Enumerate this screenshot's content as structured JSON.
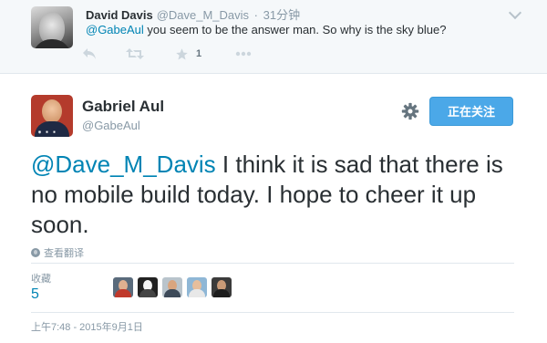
{
  "reply_tweet": {
    "author_name": "David Davis",
    "author_handle": "@Dave_M_Davis",
    "separator": "·",
    "time": "31分钟",
    "mention": "@GabeAul",
    "text": " you seem to be the answer man. So why is the sky blue?",
    "actions": {
      "reply_icon": "reply-icon",
      "retweet_icon": "retweet-icon",
      "favorite_icon": "star-icon",
      "favorite_count": "1",
      "more_icon": "more-dots-icon"
    }
  },
  "main_tweet": {
    "author_name": "Gabriel Aul",
    "author_handle": "@GabeAul",
    "follow_button_label": "正在关注",
    "settings_icon": "gear-icon",
    "mention": "@Dave_M_Davis",
    "text": " I think it is sad that there is no mobile build today. I hope to cheer it up soon.",
    "translate_label": "查看翻译",
    "stats": {
      "favorites_label": "收藏",
      "favorites_count": "5"
    },
    "timestamp": "上午7:48 - 2015年9月1日"
  },
  "colors": {
    "link": "#0084b4",
    "follow_button": "#4ba8e8",
    "muted_text": "#8899a6",
    "reply_background": "#f5f8fa"
  }
}
